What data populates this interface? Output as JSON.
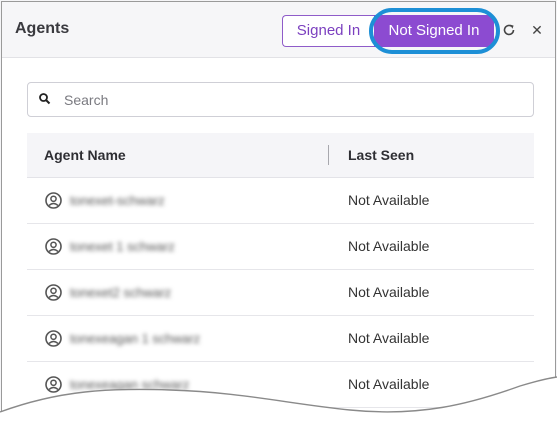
{
  "header": {
    "title": "Agents",
    "toggle_signed_in": "Signed In",
    "toggle_not_signed_in": "Not Signed In",
    "active_toggle": "Not Signed In",
    "refresh_icon": "refresh-icon",
    "close_icon": "close-icon"
  },
  "search": {
    "placeholder": "Search",
    "value": ""
  },
  "table": {
    "columns": [
      "Agent Name",
      "Last Seen"
    ],
    "rows": [
      {
        "name": "tonexet-schwarz",
        "last_seen": "Not Available"
      },
      {
        "name": "tonexet 1 schwarz",
        "last_seen": "Not Available"
      },
      {
        "name": "tonexet2 schwarz",
        "last_seen": "Not Available"
      },
      {
        "name": "tonexeagan 1 schwarz",
        "last_seen": "Not Available"
      },
      {
        "name": "tonexeagan schwarz",
        "last_seen": "Not Available"
      }
    ]
  },
  "colors": {
    "accent": "#8c4bd1",
    "highlight": "#1d8fd6"
  }
}
